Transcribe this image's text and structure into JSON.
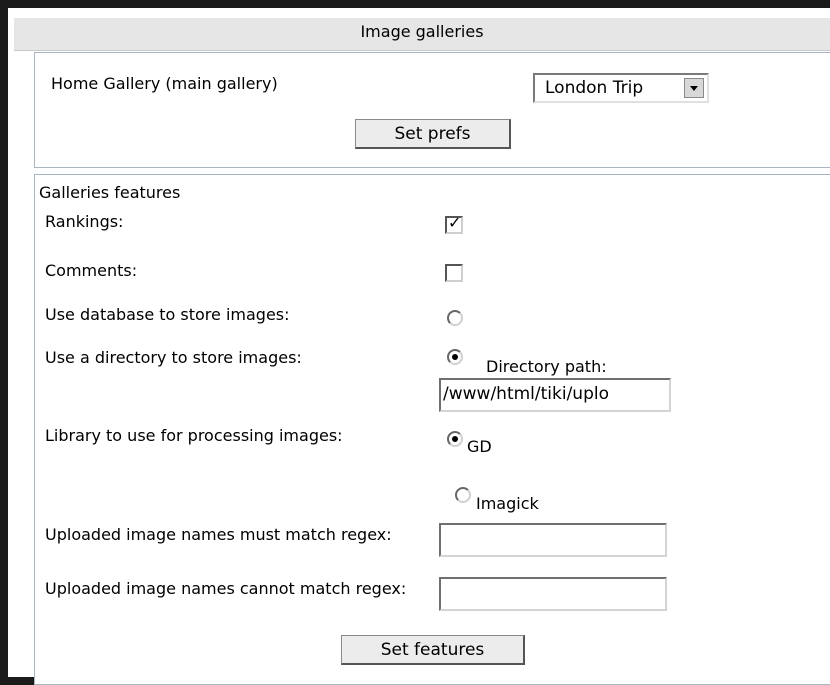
{
  "header": {
    "title": "Image galleries"
  },
  "home_gallery": {
    "label": "Home Gallery (main gallery)",
    "selected": "London Trip",
    "button": "Set prefs"
  },
  "features": {
    "section_title": "Galleries features",
    "rankings": {
      "label": "Rankings:",
      "checked": true
    },
    "comments": {
      "label": "Comments:",
      "checked": false
    },
    "use_db": {
      "label": "Use database to store images:",
      "selected": false
    },
    "use_dir": {
      "label": "Use a directory to store images:",
      "selected": true,
      "path_label": "Directory path:",
      "path_value": "/www/html/tiki/uplo"
    },
    "library": {
      "label": "Library to use for processing images:",
      "options": [
        "GD",
        "Imagick"
      ],
      "selected": "GD"
    },
    "regex_must": {
      "label": "Uploaded image names must match regex:",
      "value": ""
    },
    "regex_cannot": {
      "label": "Uploaded image names cannot match regex:",
      "value": ""
    },
    "button": "Set features"
  },
  "colors": {
    "header_bg": "#e6e6e6",
    "border": "#a9b5c1",
    "outer_bg": "#1b1b1b"
  }
}
